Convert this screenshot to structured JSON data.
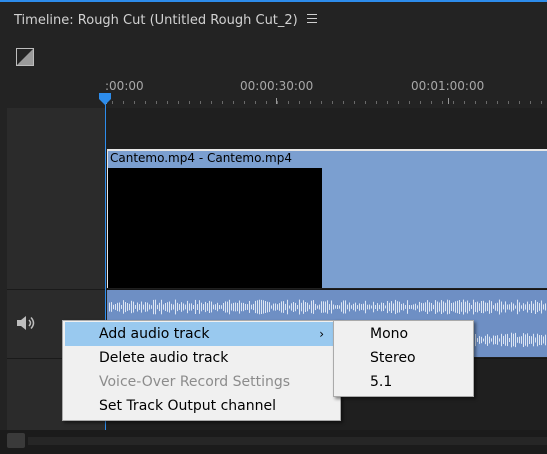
{
  "panel": {
    "title": "Timeline: Rough Cut (Untitled Rough Cut_2)"
  },
  "icons": {
    "menu": "hamburger-icon",
    "snap": "snap-icon",
    "speaker": "speaker-icon",
    "playhead": "playhead-icon"
  },
  "colors": {
    "accent": "#2d8ceb",
    "video_clip": "#7b9fd0",
    "audio_clip": "#6e8fc4",
    "menu_highlight": "#99c9ef",
    "waveform": "#f0f4fb"
  },
  "ruler": {
    "labels": [
      ":00:00",
      "00:00:30:00",
      "00:01:00:00"
    ]
  },
  "clip": {
    "label": "Cantemo.mp4 - Cantemo.mp4"
  },
  "context_menu": {
    "items": [
      {
        "label": "Add audio track",
        "highlighted": true,
        "disabled": false,
        "has_submenu": true
      },
      {
        "label": "Delete audio track",
        "highlighted": false,
        "disabled": false,
        "has_submenu": false
      },
      {
        "label": "Voice-Over Record Settings",
        "highlighted": false,
        "disabled": true,
        "has_submenu": false
      },
      {
        "label": "Set Track Output channel",
        "highlighted": false,
        "disabled": false,
        "has_submenu": false
      }
    ],
    "submenu_arrow": "›"
  },
  "submenu": {
    "items": [
      "Mono",
      "Stereo",
      "5.1"
    ]
  }
}
